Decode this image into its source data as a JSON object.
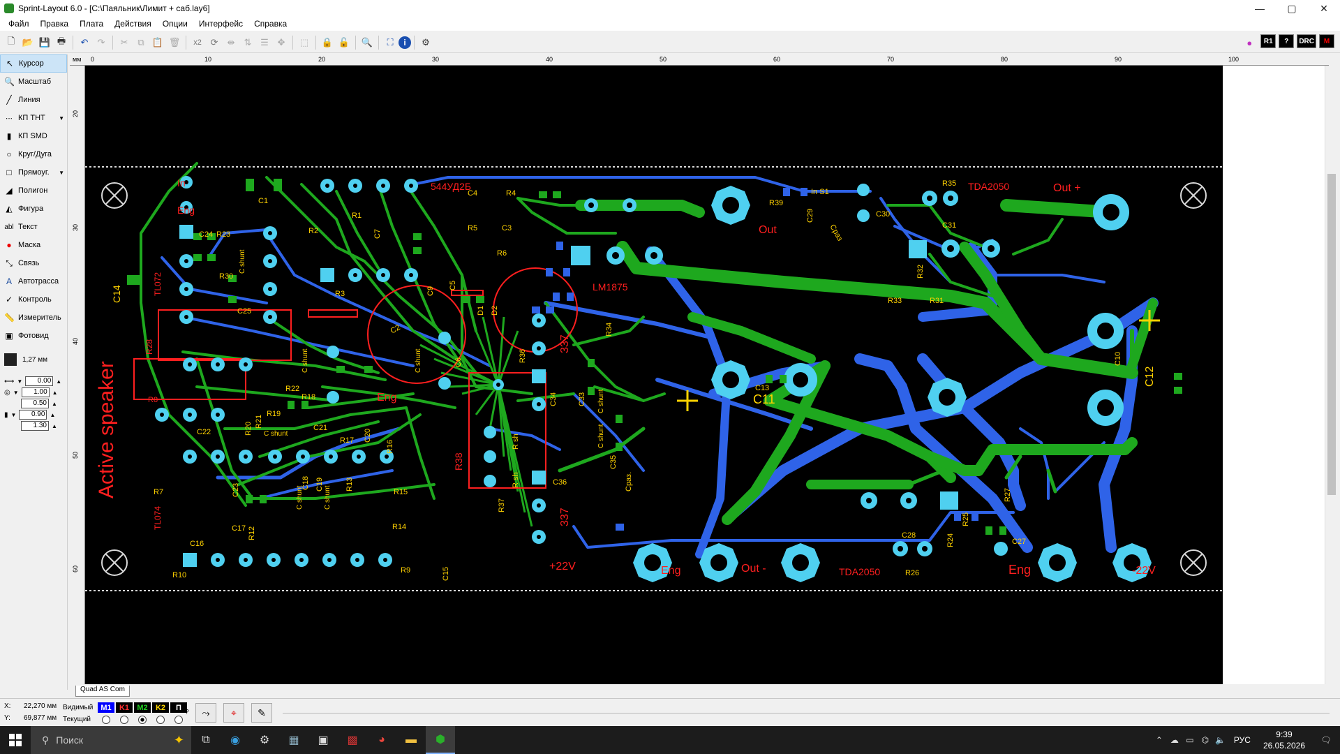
{
  "window": {
    "title": "Sprint-Layout 6.0 - [C:\\Паяльник\\Лимит + саб.lay6]",
    "minimize": "—",
    "maximize": "▢",
    "close": "✕"
  },
  "menu": [
    "Файл",
    "Правка",
    "Плата",
    "Действия",
    "Опции",
    "Интерфейс",
    "Справка"
  ],
  "toolbar": {
    "zoom_factor": "x2",
    "badges": [
      "R1",
      "?",
      "DRC",
      "M"
    ]
  },
  "tools": [
    {
      "label": "Курсор",
      "icon": "cursor-icon"
    },
    {
      "label": "Масштаб",
      "icon": "zoom-icon"
    },
    {
      "label": "Линия",
      "icon": "line-icon"
    },
    {
      "label": "КП ТНТ",
      "icon": "tht-pad-icon"
    },
    {
      "label": "КП SMD",
      "icon": "smd-pad-icon"
    },
    {
      "label": "Круг/Дуга",
      "icon": "circle-icon"
    },
    {
      "label": "Прямоуг.",
      "icon": "rectangle-icon"
    },
    {
      "label": "Полигон",
      "icon": "polygon-icon"
    },
    {
      "label": "Фигура",
      "icon": "figure-icon"
    },
    {
      "label": "Текст",
      "icon": "text-icon"
    },
    {
      "label": "Маска",
      "icon": "mask-icon"
    },
    {
      "label": "Связь",
      "icon": "connection-icon"
    },
    {
      "label": "Автотрасса",
      "icon": "autoroute-icon"
    },
    {
      "label": "Контроль",
      "icon": "check-icon"
    },
    {
      "label": "Измеритель",
      "icon": "measure-icon"
    },
    {
      "label": "Фотовид",
      "icon": "photo-view-icon"
    }
  ],
  "grid": "1,27 мм",
  "values": [
    "0.00",
    "1.00",
    "0.50",
    "0.90",
    "1.30"
  ],
  "ruler": {
    "unit": "мм",
    "top": [
      "0",
      "10",
      "20",
      "30",
      "40",
      "50",
      "60",
      "70",
      "80",
      "90",
      "100"
    ],
    "left": [
      "20",
      "30",
      "40",
      "50",
      "60"
    ]
  },
  "pcb": {
    "labels_red": [
      "In",
      "Eng",
      "544УД2Б",
      "Out",
      "LM1875",
      "Active speaker",
      "TL072",
      "TL074",
      "Eng",
      "337",
      "337",
      "+22V",
      "Eng",
      "Out -",
      "TDA2050",
      "Eng",
      "-22V",
      "Out +",
      "TDA2050",
      "R38",
      "R28",
      "R8"
    ],
    "labels_yellow": [
      "C1",
      "C24",
      "R23",
      "R30",
      "C25",
      "C14",
      "R1",
      "R2",
      "C7",
      "R3",
      "C9",
      "C4",
      "R4",
      "R5",
      "C3",
      "R6",
      "C5",
      "D1",
      "D2",
      "R39",
      "In S1",
      "C29",
      "Cраз",
      "C30",
      "R35",
      "C31",
      "R32",
      "R33",
      "R31",
      "R34",
      "C10",
      "C12",
      "C13",
      "C11",
      "R36",
      "C34",
      "C33",
      "C35",
      "C36",
      "R37",
      "Cраз.",
      "C28",
      "R24",
      "R25",
      "R27",
      "C27",
      "R26",
      "R22",
      "R18",
      "R19",
      "R20",
      "R21",
      "C21",
      "R17",
      "C20",
      "R16",
      "R15",
      "R14",
      "R9",
      "C15",
      "C22",
      "R7",
      "C23",
      "C18",
      "C19",
      "R13",
      "R12",
      "C17",
      "C16",
      "R10",
      "C6",
      "C2",
      "R sh",
      "R sh",
      "C shunt",
      "C shunt",
      "C shunt",
      "C shunt",
      "C shunt",
      "C shunt",
      "C shunt",
      "C shunt"
    ]
  },
  "sheet_tab": "Quad AS Com",
  "status": {
    "x_label": "X:",
    "x_value": "22,270 мм",
    "y_label": "Y:",
    "y_value": "69,877 мм",
    "visible_label": "Видимый",
    "current_label": "Текущий",
    "layers": [
      {
        "name": "M1",
        "bg": "#0000ff",
        "fg": "#ffffff"
      },
      {
        "name": "K1",
        "bg": "#000000",
        "fg": "#ff3030"
      },
      {
        "name": "M2",
        "bg": "#000000",
        "fg": "#20d020"
      },
      {
        "name": "K2",
        "bg": "#000000",
        "fg": "#ffd700"
      },
      {
        "name": "П",
        "bg": "#000000",
        "fg": "#ffffff"
      }
    ],
    "help": "?"
  },
  "taskbar": {
    "search_placeholder": "Поиск",
    "language": "РУС",
    "time": "9:39",
    "date": "26.05.2026"
  },
  "colors": {
    "board_bg": "#000000",
    "copper_top": "#1ea81e",
    "copper_bottom": "#2f63e8",
    "pad": "#4fd0f0",
    "silk_red": "#ff1f1f",
    "silk_yellow": "#ffd200",
    "outline": "#c8c8c8"
  }
}
